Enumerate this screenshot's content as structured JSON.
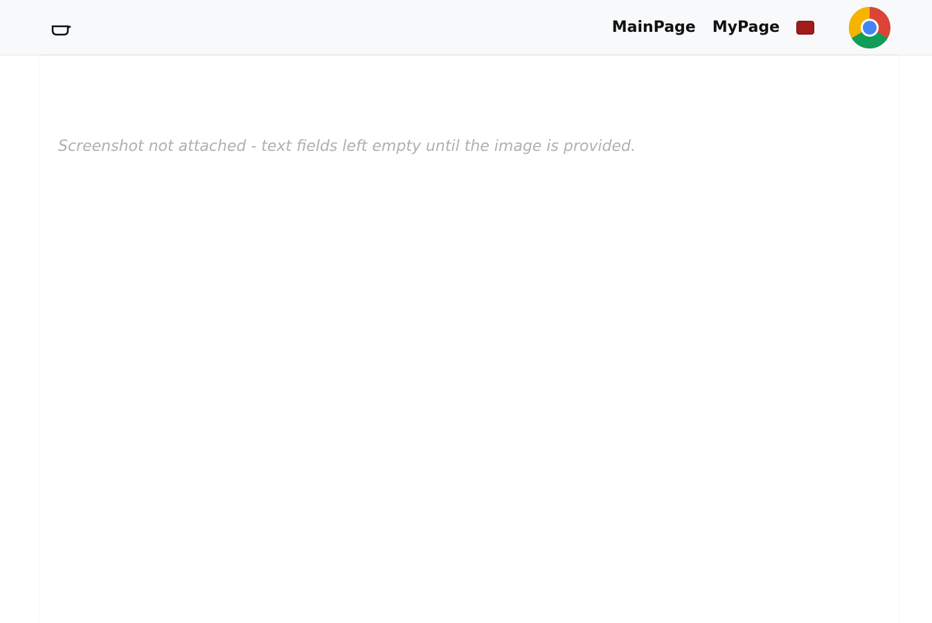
{
  "nav": {
    "links": [
      "MainPage",
      "MyPage"
    ],
    "logout_label": ""
  },
  "recipe": {
    "title": "",
    "description": "",
    "ingredients_heading": "",
    "ingredients": [],
    "steps_heading": "",
    "steps": []
  },
  "notice": "Screenshot not attached - text fields left empty until the image is provided."
}
